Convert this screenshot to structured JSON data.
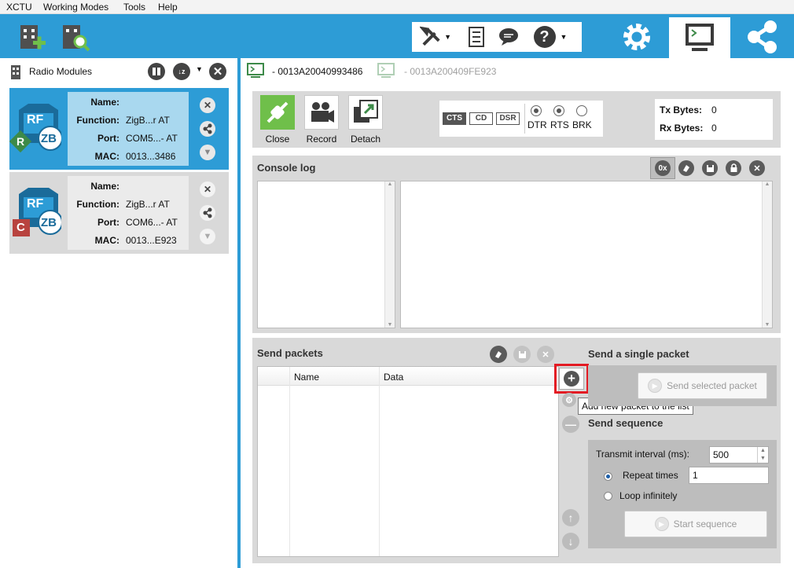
{
  "menu": [
    "XCTU",
    "Working Modes",
    "Tools",
    "Help"
  ],
  "toolbar_icons": [
    "add-module-icon",
    "discover-module-icon",
    "tools-icon",
    "profile-icon",
    "feedback-icon",
    "help-icon",
    "configuration-mode-icon",
    "consoles-mode-icon",
    "network-mode-icon"
  ],
  "left": {
    "title": "Radio Modules",
    "modules": [
      {
        "name_label": "Name:",
        "name": "",
        "function_label": "Function:",
        "function": "ZigB...r AT",
        "port_label": "Port:",
        "port": "COM5...- AT",
        "mac_label": "MAC:",
        "mac": "0013...3486",
        "badge": "R",
        "badge_color": "#3d8a49"
      },
      {
        "name_label": "Name:",
        "name": "",
        "function_label": "Function:",
        "function": "ZigB...r AT",
        "port_label": "Port:",
        "port": "COM6...- AT",
        "mac_label": "MAC:",
        "mac": "0013...E923",
        "badge": "C",
        "badge_color": "#b8433f"
      }
    ],
    "rf_text": "RF",
    "zb_text": "ZB"
  },
  "tabs": [
    {
      "label": "- 0013A20040993486",
      "active": true
    },
    {
      "label": "- 0013A200409FE923",
      "active": false
    }
  ],
  "actions": {
    "close": "Close",
    "record": "Record",
    "detach": "Detach"
  },
  "lines": {
    "cts": "CTS",
    "cd": "CD",
    "dsr": "DSR",
    "dtr": "DTR",
    "rts": "RTS",
    "brk": "BRK"
  },
  "bytes": {
    "tx_label": "Tx Bytes:",
    "tx": "0",
    "rx_label": "Rx Bytes:",
    "rx": "0"
  },
  "console": {
    "title": "Console log",
    "hex_label": "0x"
  },
  "send_packets": {
    "title": "Send packets",
    "col_name": "Name",
    "col_data": "Data"
  },
  "tooltip": "Add new packet to the list",
  "single": {
    "title": "Send a single packet",
    "button": "Send selected packet"
  },
  "sequence": {
    "title": "Send sequence",
    "interval_label": "Transmit interval (ms):",
    "interval_value": "500",
    "repeat_label": "Repeat times",
    "repeat_value": "1",
    "loop_label": "Loop infinitely",
    "start_button": "Start sequence"
  },
  "colors": {
    "accent": "#2d9cd6",
    "selected_card": "#a9d8ef",
    "highlight": "#e31b23"
  }
}
